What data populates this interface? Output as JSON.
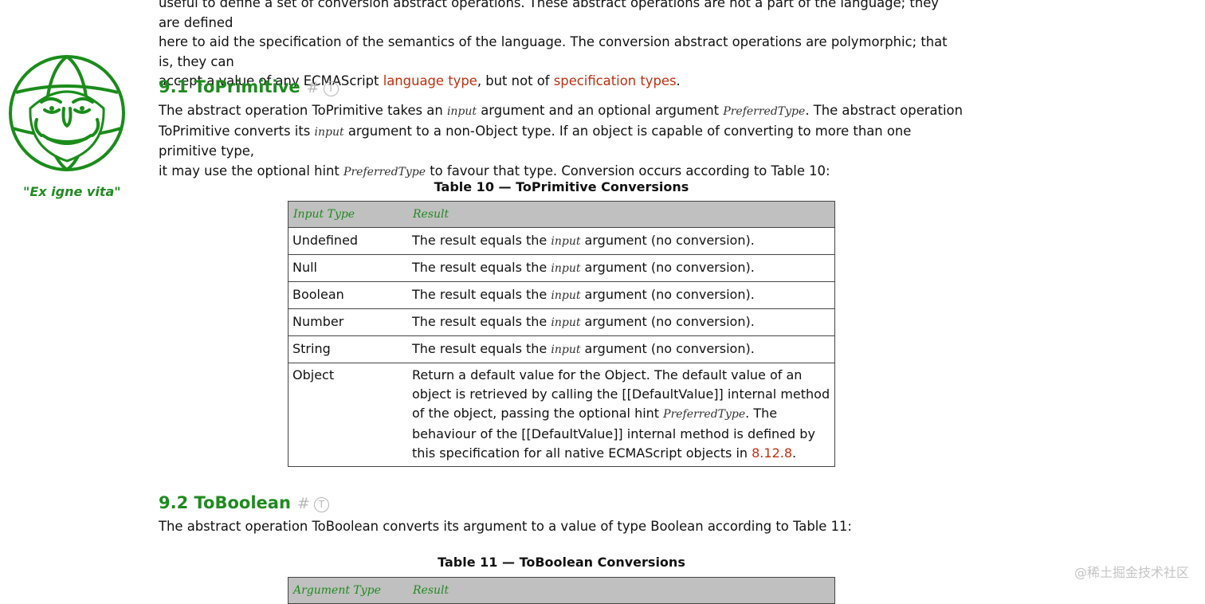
{
  "motto": "\"Ex igne vita\"",
  "intro": {
    "line1": "useful to define a set of conversion abstract operations. These abstract operations are not a part of the language; they are defined",
    "line2": "here to aid the specification of the semantics of the language. The conversion abstract operations are polymorphic; that is, they can",
    "line3_a": "accept a value of any ECMAScript ",
    "link_language_type": "language type",
    "line3_b": ", but not of ",
    "link_specification_types": "specification types",
    "line3_c": "."
  },
  "section_91": {
    "title": "9.1 ToPrimitive",
    "hash": "#",
    "tee": "T",
    "p_a": "The abstract operation ToPrimitive takes an ",
    "arg_input": "input",
    "p_b": " argument and an optional argument ",
    "arg_preferred": "PreferredType",
    "p_c": ". The abstract operation",
    "p_d": "ToPrimitive converts its ",
    "p_e": " argument to a non-Object type. If an object is capable of converting to more than one primitive type,",
    "p_f": "it may use the optional hint ",
    "p_g": " to favour that type. Conversion occurs according to Table 10:"
  },
  "table10": {
    "caption": "Table 10 — ToPrimitive Conversions",
    "header_input_type": "Input Type",
    "header_result": "Result",
    "row_prefix": "The result equals the ",
    "row_arg": "input",
    "row_suffix": " argument (no conversion).",
    "types": [
      "Undefined",
      "Null",
      "Boolean",
      "Number",
      "String"
    ],
    "object_type": "Object",
    "object_a": "Return a default value for the Object. The default value of an object is retrieved by calling the [[DefaultValue]] internal method of the object, passing the optional hint ",
    "object_arg": "PreferredType",
    "object_b": ". The behaviour of the [[DefaultValue]] internal method is defined by this specification for all native ECMAScript objects in ",
    "object_link": "8.12.8",
    "object_c": "."
  },
  "section_92": {
    "title": "9.2 ToBoolean",
    "hash": "#",
    "tee": "T",
    "paragraph": "The abstract operation ToBoolean converts its argument to a value of type Boolean according to Table 11:"
  },
  "table11": {
    "caption": "Table 11 — ToBoolean Conversions",
    "header_argument_type": "Argument Type",
    "header_result": "Result"
  },
  "watermark": "@稀土掘金技术社区",
  "colors": {
    "heading_green": "#1f8a1f",
    "link_red": "#c0300f",
    "table_header_bg": "#c0c0c0"
  }
}
